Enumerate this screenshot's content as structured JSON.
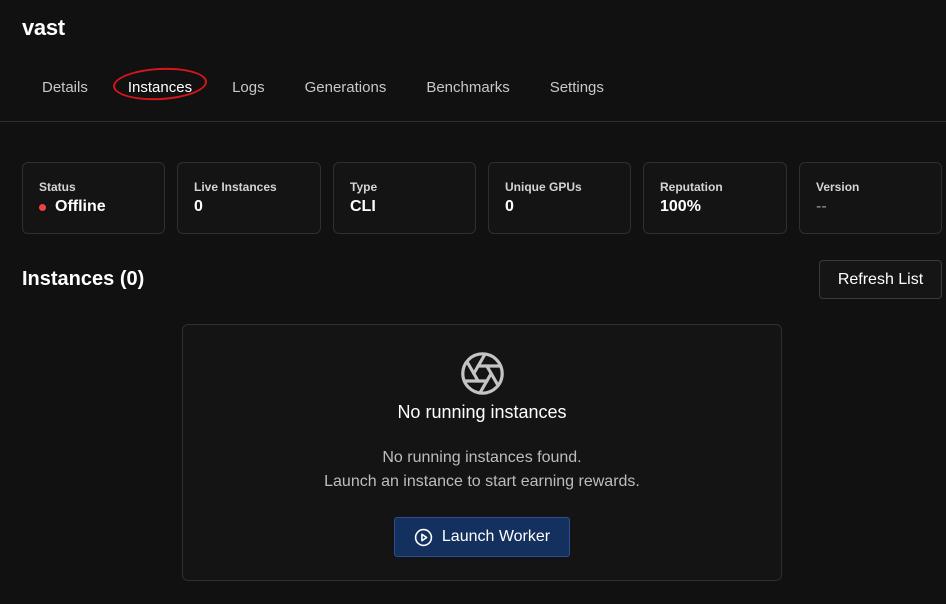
{
  "app": {
    "title": "vast"
  },
  "tabs": [
    {
      "label": "Details",
      "active": false
    },
    {
      "label": "Instances",
      "active": true
    },
    {
      "label": "Logs",
      "active": false
    },
    {
      "label": "Generations",
      "active": false
    },
    {
      "label": "Benchmarks",
      "active": false
    },
    {
      "label": "Settings",
      "active": false
    }
  ],
  "stats": [
    {
      "label": "Status",
      "value": "Offline",
      "status_color": "#ef4444"
    },
    {
      "label": "Live Instances",
      "value": "0"
    },
    {
      "label": "Type",
      "value": "CLI"
    },
    {
      "label": "Unique GPUs",
      "value": "0"
    },
    {
      "label": "Reputation",
      "value": "100%"
    },
    {
      "label": "Version",
      "value": "--"
    }
  ],
  "instances": {
    "title": "Instances (0)",
    "refresh_label": "Refresh List",
    "empty": {
      "icon": "aperture-icon",
      "title": "No running instances",
      "line1": "No running instances found.",
      "line2": "Launch an instance to start earning rewards.",
      "launch_label": "Launch Worker",
      "launch_icon": "play-circle-icon"
    }
  },
  "colors": {
    "background": "#111111",
    "accent_button": "#13305e",
    "annotation_circle": "#d8151b"
  }
}
